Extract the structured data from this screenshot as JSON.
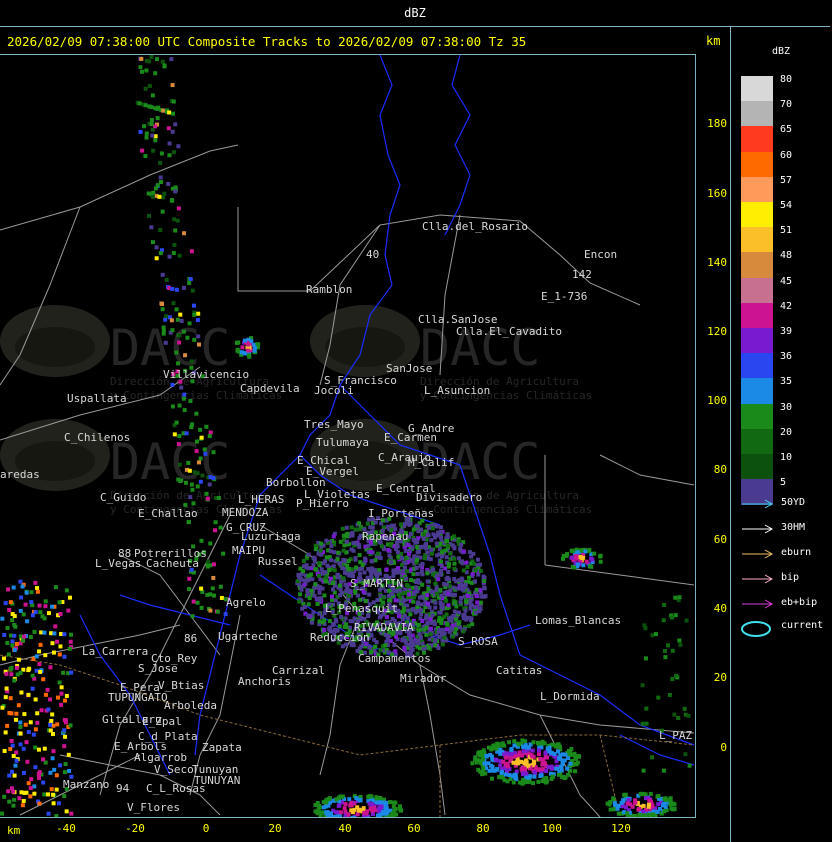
{
  "header": {
    "title": "dBZ"
  },
  "title_line": "2026/02/09 07:38:00 UTC Composite Tracks to 2026/02/09 07:38:00 Tz 35",
  "axes": {
    "unit": "km",
    "y_ticks": [
      "180",
      "160",
      "140",
      "120",
      "100",
      "80",
      "60",
      "40",
      "20",
      "0"
    ],
    "x_ticks": [
      "-40",
      "-20",
      "0",
      "20",
      "40",
      "60",
      "80",
      "100",
      "120"
    ]
  },
  "legend": {
    "title": "dBZ",
    "levels": [
      {
        "label": "80",
        "color": "#d8d8d8"
      },
      {
        "label": "70",
        "color": "#b4b4b4"
      },
      {
        "label": "65",
        "color": "#ff3a1e"
      },
      {
        "label": "60",
        "color": "#ff6a00"
      },
      {
        "label": "57",
        "color": "#ff9a5a"
      },
      {
        "label": "54",
        "color": "#ffee00"
      },
      {
        "label": "51",
        "color": "#fbbf28"
      },
      {
        "label": "48",
        "color": "#d88a3c"
      },
      {
        "label": "45",
        "color": "#c87090"
      },
      {
        "label": "42",
        "color": "#cc1490"
      },
      {
        "label": "39",
        "color": "#7a1ad0"
      },
      {
        "label": "36",
        "color": "#2a46f0"
      },
      {
        "label": "35",
        "color": "#1a8ae6"
      },
      {
        "label": "30",
        "color": "#1a8a1a"
      },
      {
        "label": "20",
        "color": "#116a11"
      },
      {
        "label": "10",
        "color": "#0c520c"
      },
      {
        "label": "5",
        "color": "#4a3a90"
      }
    ],
    "tracks": [
      {
        "label": "50YD",
        "color": "#40d8e8"
      },
      {
        "label": "30HM",
        "color": "#ffffff"
      },
      {
        "label": "eburn",
        "color": "#f0c060"
      },
      {
        "label": "bip",
        "color": "#ffb0c8"
      },
      {
        "label": "eb+bip",
        "color": "#e040e0"
      },
      {
        "label": "current",
        "color": "#40e0f0"
      }
    ]
  },
  "watermark": {
    "text": "DACC",
    "subtitle1": "Dirección de Agricultura",
    "subtitle2": "y Contingencias Climáticas"
  },
  "places": [
    {
      "name": "Clla.del_Rosario"
    },
    {
      "name": "Encon"
    },
    {
      "name": "142"
    },
    {
      "name": "E_1-736"
    },
    {
      "name": "Ramblon"
    },
    {
      "name": "Clla.SanJose"
    },
    {
      "name": "Clla.El_Cavadito"
    },
    {
      "name": "Villavicencio"
    },
    {
      "name": "S_Francisco"
    },
    {
      "name": "SanJose"
    },
    {
      "name": "Capdevila"
    },
    {
      "name": "Jocoli"
    },
    {
      "name": "L_Asuncion"
    },
    {
      "name": "Uspallata"
    },
    {
      "name": "Tres_Mayo"
    },
    {
      "name": "G_Andre"
    },
    {
      "name": "Tulumaya"
    },
    {
      "name": "E_Carmen"
    },
    {
      "name": "C_Chilenos"
    },
    {
      "name": "E_Chical"
    },
    {
      "name": "C_Araujo"
    },
    {
      "name": "M_Calif"
    },
    {
      "name": "aredas"
    },
    {
      "name": "E_Vergel"
    },
    {
      "name": "Borbollon"
    },
    {
      "name": "L_Violetas"
    },
    {
      "name": "E_Central"
    },
    {
      "name": "Divisadero"
    },
    {
      "name": "C_Guido"
    },
    {
      "name": "L_HERAS"
    },
    {
      "name": "P_Hierro"
    },
    {
      "name": "E_Challao"
    },
    {
      "name": "MENDOZA"
    },
    {
      "name": "I_Porteñas"
    },
    {
      "name": "G_CRUZ"
    },
    {
      "name": "Luzuriaga"
    },
    {
      "name": "Rapenau"
    },
    {
      "name": "Potrerillos"
    },
    {
      "name": "MAIPU"
    },
    {
      "name": "Russel"
    },
    {
      "name": "L_Vegas"
    },
    {
      "name": "Cacheuta"
    },
    {
      "name": "S_MARTIN"
    },
    {
      "name": "Agrelo"
    },
    {
      "name": "Lomas_Blancas"
    },
    {
      "name": "Ugarteche"
    },
    {
      "name": "L_Penasquit"
    },
    {
      "name": "RIVADAVIA"
    },
    {
      "name": "Reduccion"
    },
    {
      "name": "S_ROSA"
    },
    {
      "name": "La_Carrera"
    },
    {
      "name": "Cto_Rey"
    },
    {
      "name": "S_Jose"
    },
    {
      "name": "Carrizal"
    },
    {
      "name": "Catitas"
    },
    {
      "name": "Campamentos"
    },
    {
      "name": "Mirador"
    },
    {
      "name": "E_Pera"
    },
    {
      "name": "V_Btias"
    },
    {
      "name": "Anchoris"
    },
    {
      "name": "TUPUNGATO"
    },
    {
      "name": "L_Dormida"
    },
    {
      "name": "Arboleda"
    },
    {
      "name": "GltaLlaru"
    },
    {
      "name": "E_Zpal"
    },
    {
      "name": "C_d_Plata"
    },
    {
      "name": "L_PAZ"
    },
    {
      "name": "E_Arbols"
    },
    {
      "name": "Zapata"
    },
    {
      "name": "Algarrob"
    },
    {
      "name": "V_Seco"
    },
    {
      "name": "Tunuyan"
    },
    {
      "name": "TUNUYAN"
    },
    {
      "name": "Manzano"
    },
    {
      "name": "C_L_Rosas"
    },
    {
      "name": "V_Flores"
    },
    {
      "name": "40"
    },
    {
      "name": "88"
    },
    {
      "name": "86"
    },
    {
      "name": "94"
    }
  ]
}
